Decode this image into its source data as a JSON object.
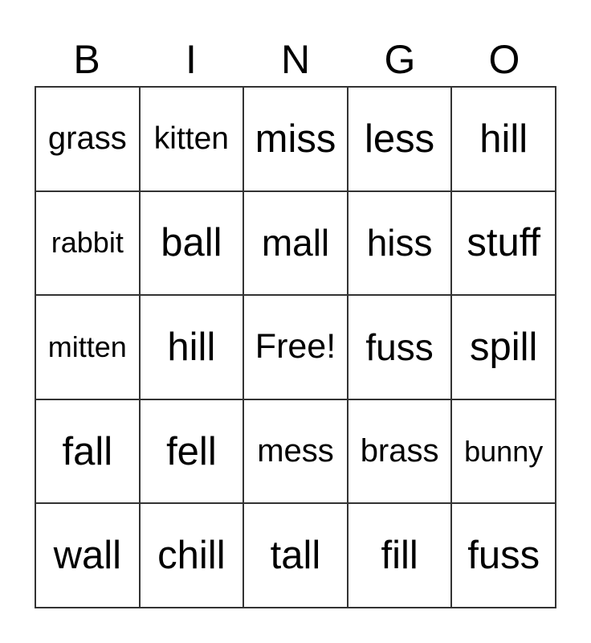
{
  "header": [
    "B",
    "I",
    "N",
    "G",
    "O"
  ],
  "rows": [
    [
      "grass",
      "kitten",
      "miss",
      "less",
      "hill"
    ],
    [
      "rabbit",
      "ball",
      "mall",
      "hiss",
      "stuff"
    ],
    [
      "mitten",
      "hill",
      "Free!",
      "fuss",
      "spill"
    ],
    [
      "fall",
      "fell",
      "mess",
      "brass",
      "bunny"
    ],
    [
      "wall",
      "chill",
      "tall",
      "fill",
      "fuss"
    ]
  ]
}
